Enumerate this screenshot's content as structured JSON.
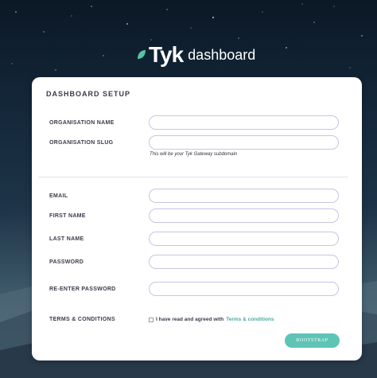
{
  "app": {
    "brand": "Tyk",
    "subtitle": "dashboard"
  },
  "form": {
    "title": "DASHBOARD SETUP",
    "org_name_label": "ORGANISATION NAME",
    "org_name_value": "",
    "org_slug_label": "ORGANISATION SLUG",
    "org_slug_value": "",
    "org_slug_hint": "This will be your Tyk Gateway subdomain",
    "email_label": "EMAIL",
    "first_name_label": "FIRST NAME",
    "last_name_label": "LAST NAME",
    "password_label": "PASSWORD",
    "reenter_password_label": "RE-ENTER PASSWORD",
    "terms_label": "TERMS & CONDITIONS",
    "terms_text": "I have read and agreed with",
    "terms_link": "Terms & conditions",
    "terms_checked": false,
    "submit_label": "BOOTSTRAP"
  },
  "colors": {
    "accent": "#5ec4b6",
    "link": "#4aa9a0",
    "logo_leaf": "#56c2a8",
    "field_border": "#c9c4e6",
    "background_top": "#0b1826"
  },
  "icons": {
    "logo": "tyk-leaf-icon"
  }
}
